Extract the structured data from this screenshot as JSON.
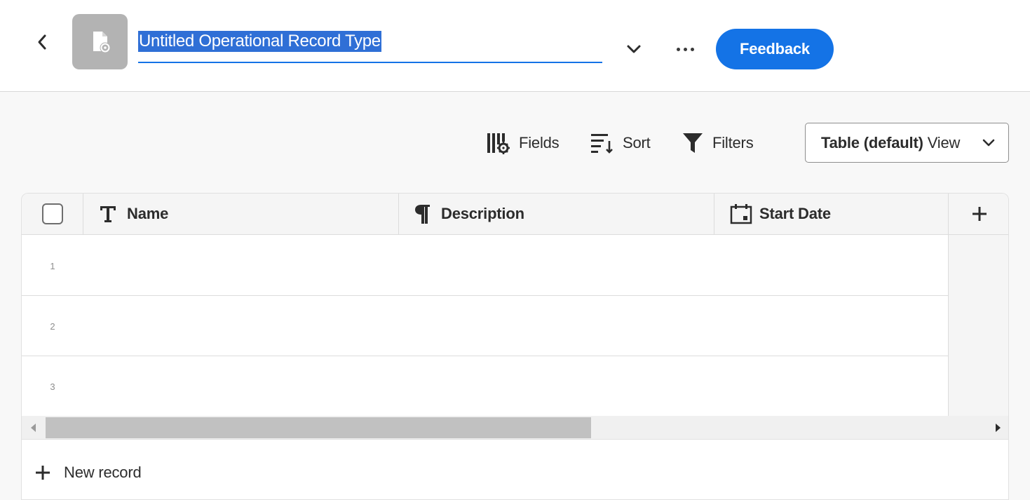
{
  "header": {
    "title": "Untitled Operational Record Type",
    "back_icon": "chevron-left-icon",
    "type_icon": "operational-record-icon",
    "feedback_label": "Feedback"
  },
  "toolbar": {
    "fields_label": "Fields",
    "sort_label": "Sort",
    "filters_label": "Filters",
    "view_select": {
      "selected_bold": "Table (default)",
      "selected_suffix": "View"
    }
  },
  "table": {
    "columns": [
      {
        "label": "Name",
        "icon": "text-type-icon"
      },
      {
        "label": "Description",
        "icon": "paragraph-icon"
      },
      {
        "label": "Start Date",
        "icon": "calendar-icon"
      }
    ],
    "rows": [
      "1",
      "2",
      "3"
    ],
    "new_record_label": "New record"
  },
  "colors": {
    "accent": "#1473e6",
    "selection": "#2f6fd6",
    "icon_tile": "#b3b3b3"
  }
}
